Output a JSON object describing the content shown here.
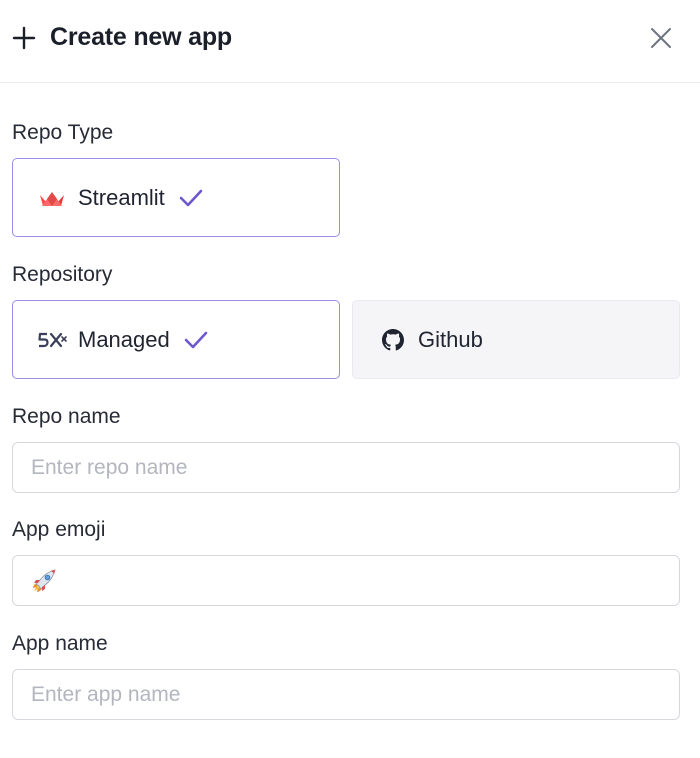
{
  "header": {
    "title": "Create new app",
    "plus_icon": "plus-icon",
    "close_icon": "close-icon"
  },
  "repo_type": {
    "label": "Repo Type",
    "options": [
      {
        "label": "Streamlit",
        "icon": "streamlit-crown-icon",
        "selected": true
      }
    ]
  },
  "repository": {
    "label": "Repository",
    "options": [
      {
        "label": "Managed",
        "icon": "5x-logo-icon",
        "selected": true
      },
      {
        "label": "Github",
        "icon": "github-icon",
        "selected": false
      }
    ]
  },
  "repo_name": {
    "label": "Repo name",
    "placeholder": "Enter repo name",
    "value": ""
  },
  "app_emoji": {
    "label": "App emoji",
    "value": "rocket"
  },
  "app_name": {
    "label": "App name",
    "placeholder": "Enter app name",
    "value": ""
  },
  "colors": {
    "accent": "#6e56cf",
    "selected_border": "#9b8ee8",
    "streamlit_red": "#ff4b4b"
  }
}
